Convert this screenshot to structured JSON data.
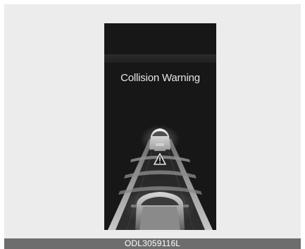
{
  "display": {
    "warning_text": "Collision Warning"
  },
  "figure": {
    "caption_code": "ODL3059116L"
  },
  "icons": {
    "lead_vehicle": "front-car-icon",
    "warning": "warning-triangle-icon",
    "own_vehicle": "own-car-icon"
  }
}
